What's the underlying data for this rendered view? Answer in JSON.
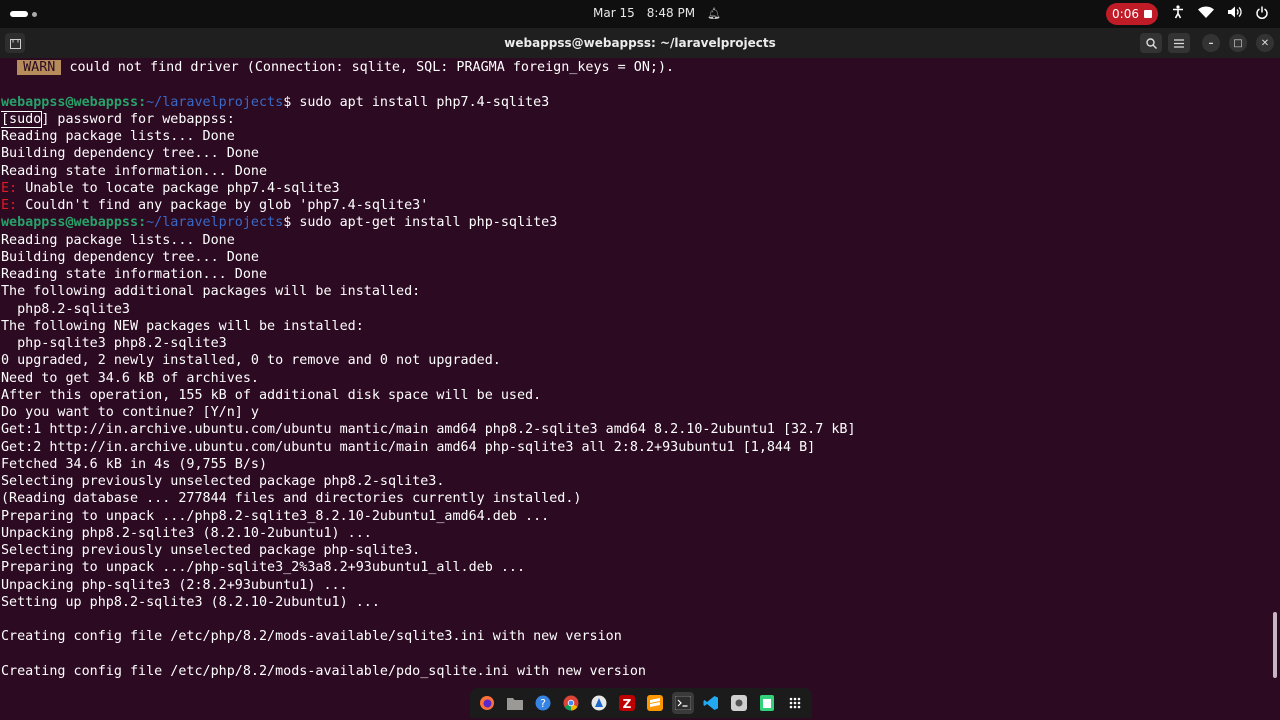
{
  "topbar": {
    "date": "Mar 15",
    "time": "8:48 PM",
    "recording_time": "0:06"
  },
  "window": {
    "title": "webappss@webappss: ~/laravelprojects"
  },
  "terminal": {
    "warn_badge": "WARN",
    "warn_text": "could not find driver (Connection: sqlite, SQL: PRAGMA foreign_keys = ON;).",
    "prompt_user": "webappss@webappss",
    "prompt_path": "~/laravelprojects",
    "cmd1": "sudo apt install php7.4-sqlite3",
    "sudo_label": "[sudo",
    "sudo_rest": "] password for webappss:",
    "l_reading1": "Reading package lists... Done",
    "l_building1": "Building dependency tree... Done",
    "l_state1": "Reading state information... Done",
    "err_prefix": "E:",
    "err1": "Unable to locate package php7.4-sqlite3",
    "err2": "Couldn't find any package by glob 'php7.4-sqlite3'",
    "cmd2": "sudo apt-get install php-sqlite3",
    "l_reading2": "Reading package lists... Done",
    "l_building2": "Building dependency tree... Done",
    "l_state2": "Reading state information... Done",
    "l_additional": "The following additional packages will be installed:",
    "l_additional_pkgs": "  php8.2-sqlite3",
    "l_new": "The following NEW packages will be installed:",
    "l_new_pkgs": "  php-sqlite3 php8.2-sqlite3",
    "l_upgraded": "0 upgraded, 2 newly installed, 0 to remove and 0 not upgraded.",
    "l_need": "Need to get 34.6 kB of archives.",
    "l_after": "After this operation, 155 kB of additional disk space will be used.",
    "l_continue": "Do you want to continue? [Y/n] y",
    "l_get1": "Get:1 http://in.archive.ubuntu.com/ubuntu mantic/main amd64 php8.2-sqlite3 amd64 8.2.10-2ubuntu1 [32.7 kB]",
    "l_get2": "Get:2 http://in.archive.ubuntu.com/ubuntu mantic/main amd64 php-sqlite3 all 2:8.2+93ubuntu1 [1,844 B]",
    "l_fetched": "Fetched 34.6 kB in 4s (9,755 B/s)",
    "l_sel1": "Selecting previously unselected package php8.2-sqlite3.",
    "l_readdb": "(Reading database ... 277844 files and directories currently installed.)",
    "l_prep1": "Preparing to unpack .../php8.2-sqlite3_8.2.10-2ubuntu1_amd64.deb ...",
    "l_unpack1": "Unpacking php8.2-sqlite3 (8.2.10-2ubuntu1) ...",
    "l_sel2": "Selecting previously unselected package php-sqlite3.",
    "l_prep2": "Preparing to unpack .../php-sqlite3_2%3a8.2+93ubuntu1_all.deb ...",
    "l_unpack2": "Unpacking php-sqlite3 (2:8.2+93ubuntu1) ...",
    "l_setup1": "Setting up php8.2-sqlite3 (8.2.10-2ubuntu1) ...",
    "l_config1": "Creating config file /etc/php/8.2/mods-available/sqlite3.ini with new version",
    "l_config2": "Creating config file /etc/php/8.2/mods-available/pdo_sqlite.ini with new version"
  },
  "colors": {
    "terminal_bg": "#2c0a22",
    "prompt_user": "#26a269",
    "prompt_path": "#3a68c5",
    "error": "#e01b24",
    "warn_badge": "#b58c5a",
    "record": "#c01c28"
  },
  "dock": {
    "apps": [
      "firefox-icon",
      "files-icon",
      "help-icon",
      "chrome-icon",
      "app-center-icon",
      "filezilla-icon",
      "sublime-icon",
      "terminal-icon",
      "vscode-icon",
      "screenshot-icon",
      "text-editor-icon",
      "app-grid-icon"
    ]
  }
}
